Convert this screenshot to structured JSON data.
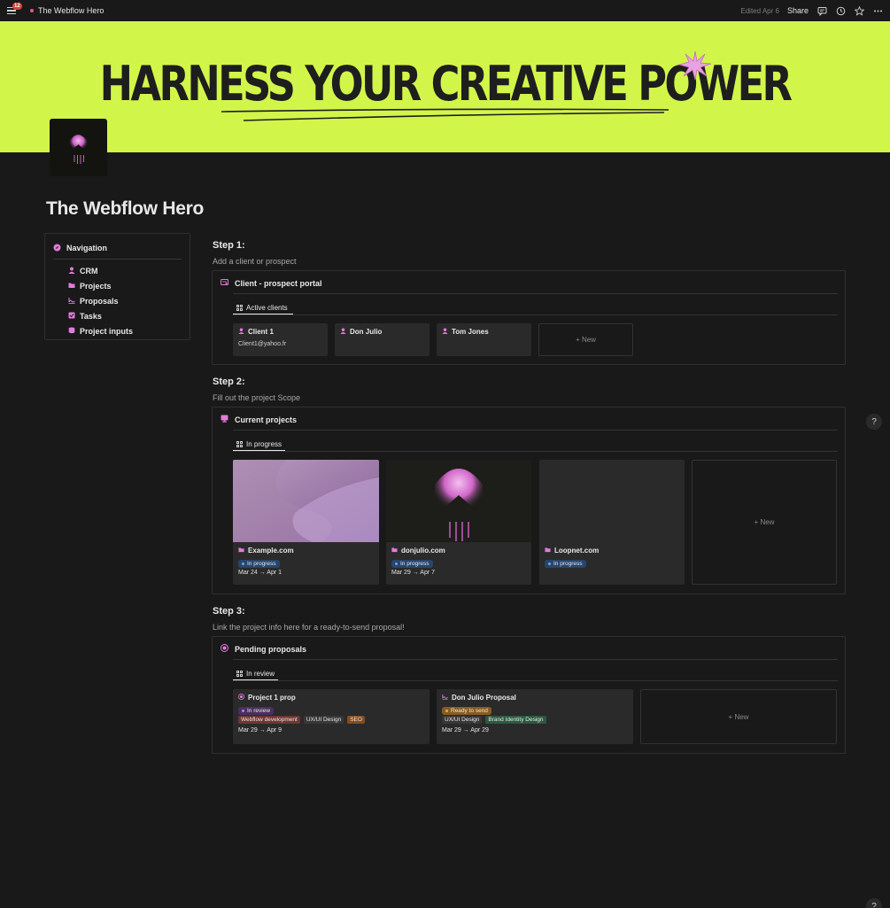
{
  "topbar": {
    "notifications": "12",
    "title": "The Webflow Hero",
    "edited": "Edited Apr 6",
    "share": "Share"
  },
  "cover": {
    "headline": "HARNESS YOUR CREATIVE POWER",
    "background": "#d2f54a"
  },
  "page": {
    "title": "The Webflow Hero"
  },
  "navigation": {
    "heading": "Navigation",
    "items": [
      {
        "label": "CRM",
        "icon": "person-icon"
      },
      {
        "label": "Projects",
        "icon": "folder-icon"
      },
      {
        "label": "Proposals",
        "icon": "signature-icon"
      },
      {
        "label": "Tasks",
        "icon": "checkbox-icon"
      },
      {
        "label": "Project inputs",
        "icon": "database-icon"
      }
    ]
  },
  "step1": {
    "title": "Step 1:",
    "subtitle": "Add a client or prospect",
    "section_title": "Client - prospect portal",
    "tab": "Active clients",
    "cards": [
      {
        "name": "Client 1",
        "email": "Client1@yahoo.fr"
      },
      {
        "name": "Don Julio",
        "email": ""
      },
      {
        "name": "Tom Jones",
        "email": ""
      }
    ],
    "new_label": "+ New"
  },
  "step2": {
    "title": "Step 2:",
    "subtitle": "Fill out the project Scope",
    "section_title": "Current projects",
    "tab": "In progress",
    "cards": [
      {
        "name": "Example.com",
        "status": "In progress",
        "dates": "Mar 24 → Apr 1"
      },
      {
        "name": "donjulio.com",
        "status": "In progress",
        "dates": "Mar 29 → Apr 7"
      },
      {
        "name": "Loopnet.com",
        "status": "In progress",
        "dates": ""
      }
    ],
    "new_label": "+ New"
  },
  "step3": {
    "title": "Step 3:",
    "subtitle": "Link the project info here for a ready-to-send proposal!",
    "section_title": "Pending proposals",
    "tab": "In review",
    "cards": [
      {
        "name": "Project 1 prop",
        "status": "In review",
        "tags": [
          "Webflow development",
          "UX/UI Design",
          "SEO"
        ],
        "dates": "Mar 29 → Apr 9"
      },
      {
        "name": "Don Julio Proposal",
        "status": "Ready to send",
        "tags": [
          "UX/UI Design",
          "Brand Identity Design"
        ],
        "dates": "Mar 29 → Apr 29"
      }
    ],
    "new_label": "+ New"
  },
  "help": {
    "label": "?"
  },
  "colors": {
    "accent_pink": "#e37bd9",
    "status_blue": "#28456c",
    "status_purple": "#492f64",
    "status_orange": "#8a5b1f",
    "tag_red": "#6e3630",
    "tag_gray": "#373737",
    "tag_orange": "#854c1d",
    "tag_green": "#2b593f"
  }
}
